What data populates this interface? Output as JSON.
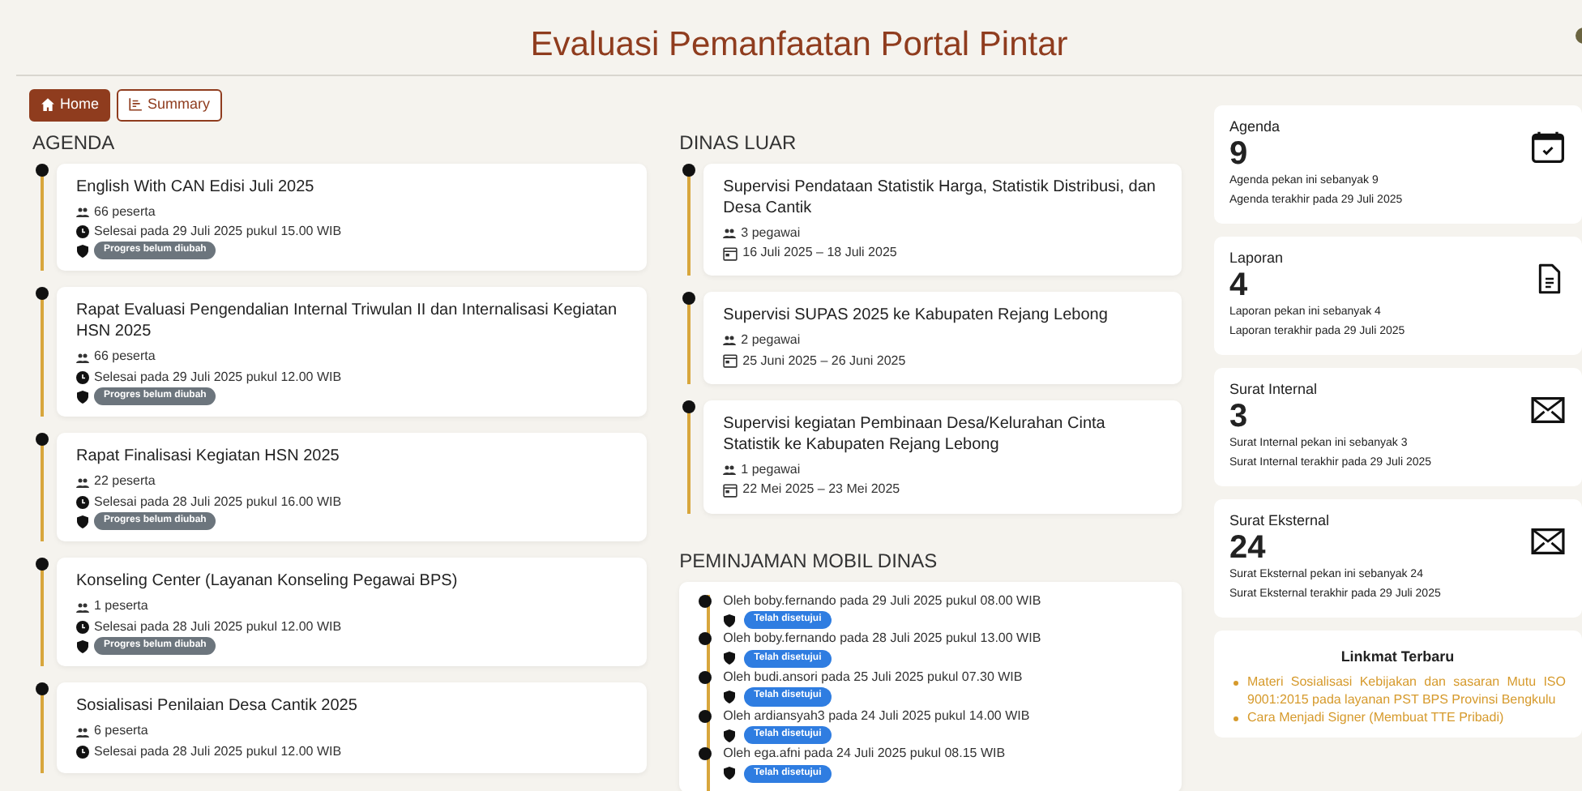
{
  "header": {
    "title": "Evaluasi Pemanfaatan Portal Pintar",
    "theme_toggle": {
      "on": true
    }
  },
  "nav": [
    {
      "label": "Home",
      "selected": true
    },
    {
      "label": "Summary",
      "selected": false
    }
  ],
  "agenda": {
    "heading": "AGENDA",
    "items": [
      {
        "title": "English With CAN Edisi Juli 2025",
        "participants": "66 peserta",
        "finished": "Selesai pada 29 Juli 2025 pukul 15.00 WIB",
        "status": "Progres belum diubah"
      },
      {
        "title": "Rapat Evaluasi Pengendalian Internal Triwulan II dan Internalisasi Kegiatan HSN 2025",
        "participants": "66 peserta",
        "finished": "Selesai pada 29 Juli 2025 pukul 12.00 WIB",
        "status": "Progres belum diubah"
      },
      {
        "title": "Rapat Finalisasi Kegiatan HSN 2025",
        "participants": "22 peserta",
        "finished": "Selesai pada 28 Juli 2025 pukul 16.00 WIB",
        "status": "Progres belum diubah"
      },
      {
        "title": "Konseling Center (Layanan Konseling Pegawai BPS)",
        "participants": "1 peserta",
        "finished": "Selesai pada 28 Juli 2025 pukul 12.00 WIB",
        "status": "Progres belum diubah"
      },
      {
        "title": "Sosialisasi Penilaian Desa Cantik 2025",
        "participants": "6 peserta",
        "finished": "Selesai pada 28 Juli 2025 pukul 12.00 WIB"
      }
    ]
  },
  "dinas_luar": {
    "heading": "DINAS LUAR",
    "items": [
      {
        "title": "Supervisi Pendataan Statistik Harga, Statistik Distribusi, dan Desa Cantik",
        "staff": "3 pegawai",
        "dates": "16 Juli 2025 – 18 Juli 2025"
      },
      {
        "title": "Supervisi SUPAS 2025 ke Kabupaten Rejang Lebong",
        "staff": "2 pegawai",
        "dates": "25 Juni 2025 – 26 Juni 2025"
      },
      {
        "title": "Supervisi kegiatan Pembinaan Desa/Kelurahan Cinta Statistik ke Kabupaten Rejang Lebong",
        "staff": "1 pegawai",
        "dates": "22 Mei 2025 – 23 Mei 2025"
      }
    ]
  },
  "mobil_dinas": {
    "heading": "PEMINJAMAN MOBIL DINAS",
    "items": [
      {
        "text": "Oleh boby.fernando pada 29 Juli 2025 pukul 08.00 WIB",
        "status": "Telah disetujui"
      },
      {
        "text": "Oleh boby.fernando pada 28 Juli 2025 pukul 13.00 WIB",
        "status": "Telah disetujui"
      },
      {
        "text": "Oleh budi.ansori pada 25 Juli 2025 pukul 07.30 WIB",
        "status": "Telah disetujui"
      },
      {
        "text": "Oleh ardiansyah3 pada 24 Juli 2025 pukul 14.00 WIB",
        "status": "Telah disetujui"
      },
      {
        "text": "Oleh ega.afni pada 24 Juli 2025 pukul 08.15 WIB",
        "status": "Telah disetujui"
      }
    ]
  },
  "stats": [
    {
      "label": "Agenda",
      "count": "9",
      "line_1": "Agenda pekan ini sebanyak 9",
      "line_2": "Agenda terakhir pada 29 Juli 2025"
    },
    {
      "label": "Laporan",
      "count": "4",
      "line_1": "Laporan pekan ini sebanyak 4",
      "line_2": "Laporan terakhir pada 29 Juli 2025"
    },
    {
      "label": "Surat Internal",
      "count": "3",
      "line_1": "Surat Internal pekan ini sebanyak 3",
      "line_2": "Surat Internal terakhir pada 29 Juli 2025"
    },
    {
      "label": "Surat Eksternal",
      "count": "24",
      "line_1": "Surat Eksternal pekan ini sebanyak 24",
      "line_2": "Surat Eksternal terakhir pada 29 Juli 2025"
    }
  ],
  "linkmat": {
    "heading": "Linkmat Terbaru",
    "links": [
      "Materi Sosialisasi Kebijakan dan sasaran Mutu ISO 9001:2015 pada layanan PST BPS Provinsi Bengkulu",
      "Cara Menjadi Signer (Membuat TTE Pribadi)"
    ]
  }
}
